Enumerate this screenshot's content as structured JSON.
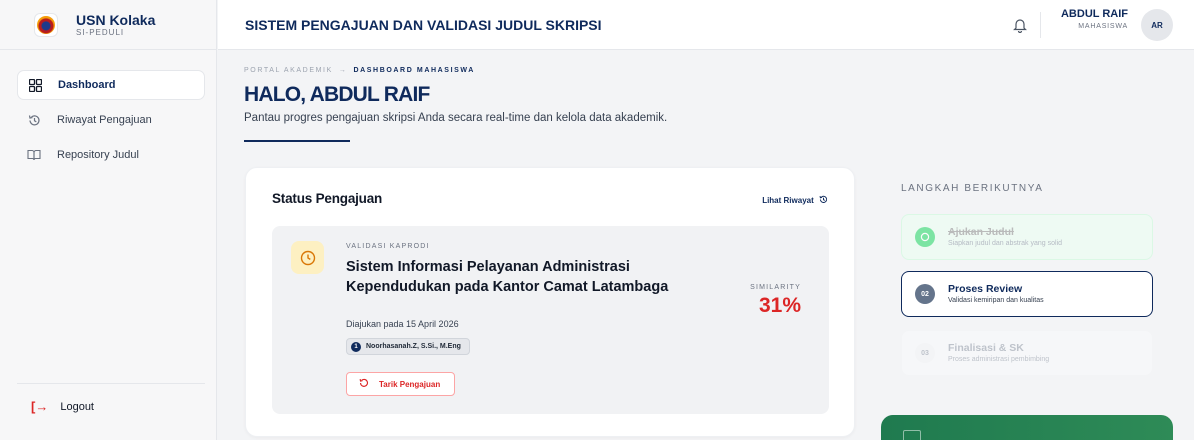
{
  "sidebar": {
    "brand_name": "USN Kolaka",
    "brand_sub": "SI-PEDULI",
    "items": [
      {
        "label": "Dashboard",
        "icon": "grid-icon",
        "active": true
      },
      {
        "label": "Riwayat Pengajuan",
        "icon": "history-icon",
        "active": false
      },
      {
        "label": "Repository Judul",
        "icon": "book-icon",
        "active": false
      }
    ],
    "logout_label": "Logout"
  },
  "header": {
    "title": "SISTEM PENGAJUAN DAN VALIDASI JUDUL SKRIPSI",
    "user_name": "ABDUL RAIF",
    "user_role": "MAHASISWA",
    "avatar_initials": "AR"
  },
  "main": {
    "breadcrumb_root": "PORTAL AKADEMIK",
    "breadcrumb_sep": "→",
    "breadcrumb_current": "DASHBOARD MAHASISWA",
    "greeting": "HALO, ABDUL RAIF",
    "subtitle": "Pantau progres pengajuan skripsi Anda secara real-time dan kelola data akademik."
  },
  "status_card": {
    "title": "Status Pengajuan",
    "link_label": "Lihat Riwayat",
    "stage_label": "VALIDASI KAPRODI",
    "thesis_title": "Sistem Informasi Pelayanan Administrasi Kependudukan pada Kantor Camat Latambaga",
    "submitted_text": "Diajukan pada 15 April 2026",
    "supervisor_index": "1",
    "supervisor_name": "Noorhasanah.Z, S.Si., M.Eng",
    "withdraw_label": "Tarik Pengajuan",
    "similarity_label": "SIMILARITY",
    "similarity_value": "31%"
  },
  "next_steps": {
    "title": "LANGKAH BERIKUTNYA",
    "steps": [
      {
        "num": "",
        "label": "Ajukan Judul",
        "desc": "Siapkan judul dan abstrak yang solid",
        "state": "done"
      },
      {
        "num": "02",
        "label": "Proses Review",
        "desc": "Validasi kemiripan dan kualitas",
        "state": "current"
      },
      {
        "num": "03",
        "label": "Finalisasi & SK",
        "desc": "Proses administrasi pembimbing",
        "state": "todo"
      }
    ]
  },
  "colors": {
    "primary": "#0f2a5c",
    "danger": "#dc2626",
    "success": "#22c55e"
  }
}
